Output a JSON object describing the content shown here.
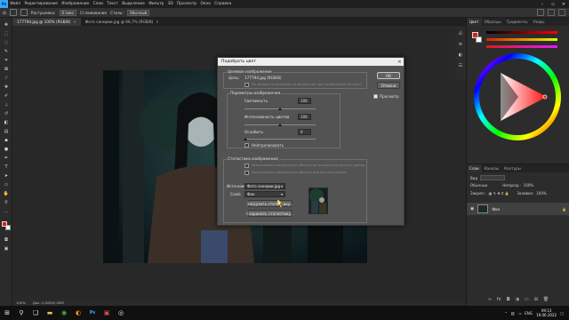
{
  "app": {
    "logo": "Ps",
    "menu": [
      "Файл",
      "Редактирование",
      "Изображение",
      "Слои",
      "Текст",
      "Выделение",
      "Фильтр",
      "3D",
      "Просмотр",
      "Окно",
      "Справка"
    ]
  },
  "options_bar": {
    "feather_label": "Растушевка:",
    "feather_value": "0 пикс",
    "smoothing_label": "Сглаживание",
    "style_label": "Стиль:",
    "style_value": "Обычный"
  },
  "tabs": [
    {
      "label": "177794.jpg @ 100% (RGB/8)",
      "active": true
    },
    {
      "label": "Фото синерии.jpg @ 66,7% (RGB/8)",
      "active": false
    }
  ],
  "status": {
    "zoom": "100%",
    "doc": "Док: 2,00M/2,00M"
  },
  "panels": {
    "top_tabs": [
      "Цвет",
      "Образцы",
      "Градиенты",
      "Узоры"
    ],
    "layers_tabs": [
      "Слои",
      "Каналы",
      "Контуры"
    ],
    "layers_kind_label": "Вид",
    "layers_mode": "Обычные",
    "opacity_label": "Непрозр.:",
    "opacity_value": "100%",
    "lock_label": "Закреп.:",
    "fill_label": "Заливка:",
    "fill_value": "100%",
    "layer_name": "Фон"
  },
  "dialog": {
    "title": "Подобрать цвет",
    "close": "✕",
    "target_header": "Целевое изображение",
    "target_label": "Цель:",
    "target_value": "177794.jpg (RGB/8)",
    "ignore_selection": "Не обращать внимания на выделение при применении настроек",
    "image_options_header": "Параметры изображения",
    "luminance_label": "Светимость",
    "luminance_value": "100",
    "intensity_label": "Интенсивность цветов",
    "intensity_value": "100",
    "fade_label": "Ослабить",
    "fade_value": "0",
    "neutralize_label": "Нейтрализовать",
    "stats_header": "Статистика изображения",
    "use_source_sel": "Использовать выделенную область источника для расчета цветов",
    "use_target_sel": "Использовать выделенную область для расчета цветов",
    "source_label": "Источник:",
    "source_value": "Фото синерии.jpg",
    "layer_label": "Слой:",
    "layer_value": "Фон",
    "load_stats": "Загрузить статистику...",
    "save_stats": "Сохранить статистику...",
    "ok": "OK",
    "cancel": "Отмена",
    "preview_label": "Просмотр",
    "preview_checked": true
  },
  "taskbar": {
    "lang": "ENG",
    "time": "09:13",
    "date": "19.06.2022"
  },
  "colors": {
    "accent": "#31a8ff",
    "foreground_swatch": "#e11b1b",
    "background_swatch": "#ffffff"
  }
}
